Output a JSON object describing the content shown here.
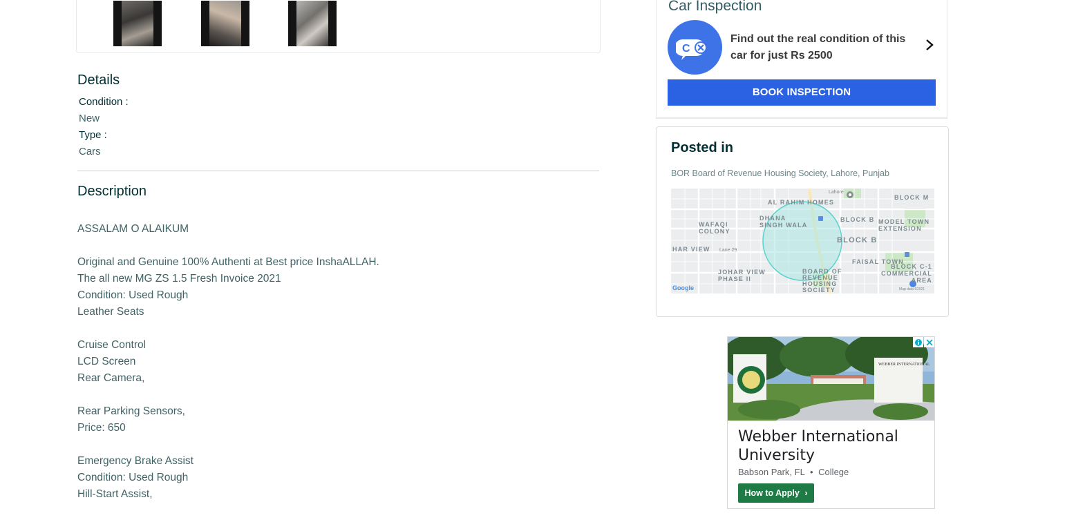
{
  "details": {
    "heading": "Details",
    "condition_label": "Condition :",
    "condition_value": "New",
    "type_label": "Type :",
    "type_value": "Cars"
  },
  "description": {
    "heading": "Description",
    "lines": [
      "ASSALAM O ALAIKUM",
      "Original and Genuine 100% Authenti at Best price InshaALLAH.",
      "The all new MG ZS 1.5 Fresh Invoice 2021",
      "Condition: Used Rough",
      "Leather Seats",
      "Cruise Control",
      "LCD Screen",
      "Rear Camera,",
      "Rear Parking Sensors,",
      "Price: 650",
      "Emergency Brake Assist",
      "Condition: Used Rough",
      "Hill-Start Assist,"
    ]
  },
  "inspection": {
    "title": "Car Inspection",
    "text": "Find out the real condition of this car for just Rs 2500",
    "button_label": "BOOK INSPECTION",
    "brand_color": "#3e73e8",
    "button_color": "#2b62e3"
  },
  "posted": {
    "title": "Posted in",
    "location": "BOR Board of Revenue Housing Society, Lahore, Punjab",
    "map_labels": {
      "al_rahim_homes": "AL RAHIM HOMES",
      "dhana_singh_wala": "DHANA SINGH WALA",
      "wafaqi_colony": "WAFAQI COLONY",
      "block_b": "BLOCK B",
      "block_m": "BLOCK M",
      "model_town_extension": "MODEL TOWN EXTENSION",
      "har_view": "HAR VIEW",
      "johar_view_phase_ii": "JOHAR VIEW PHASE II",
      "board_of_revenue_housing_society": "BOARD OF REVENUE HOUSING SOCIETY",
      "faisal_town": "FAISAL TOWN",
      "block_c1_commercial_area": "BLOCK C-1 COMMERCIAL AREA",
      "lane": "Lane 29",
      "map_data": "Map data ©2021",
      "google": "Google",
      "lahore": "Lahore"
    }
  },
  "ad": {
    "title": "Webber International University",
    "location": "Babson Park, FL",
    "category": "College",
    "button_label": "How to Apply",
    "button_color": "#1e7b46",
    "image_sign": "WEBBER INTERNATIONAL"
  }
}
